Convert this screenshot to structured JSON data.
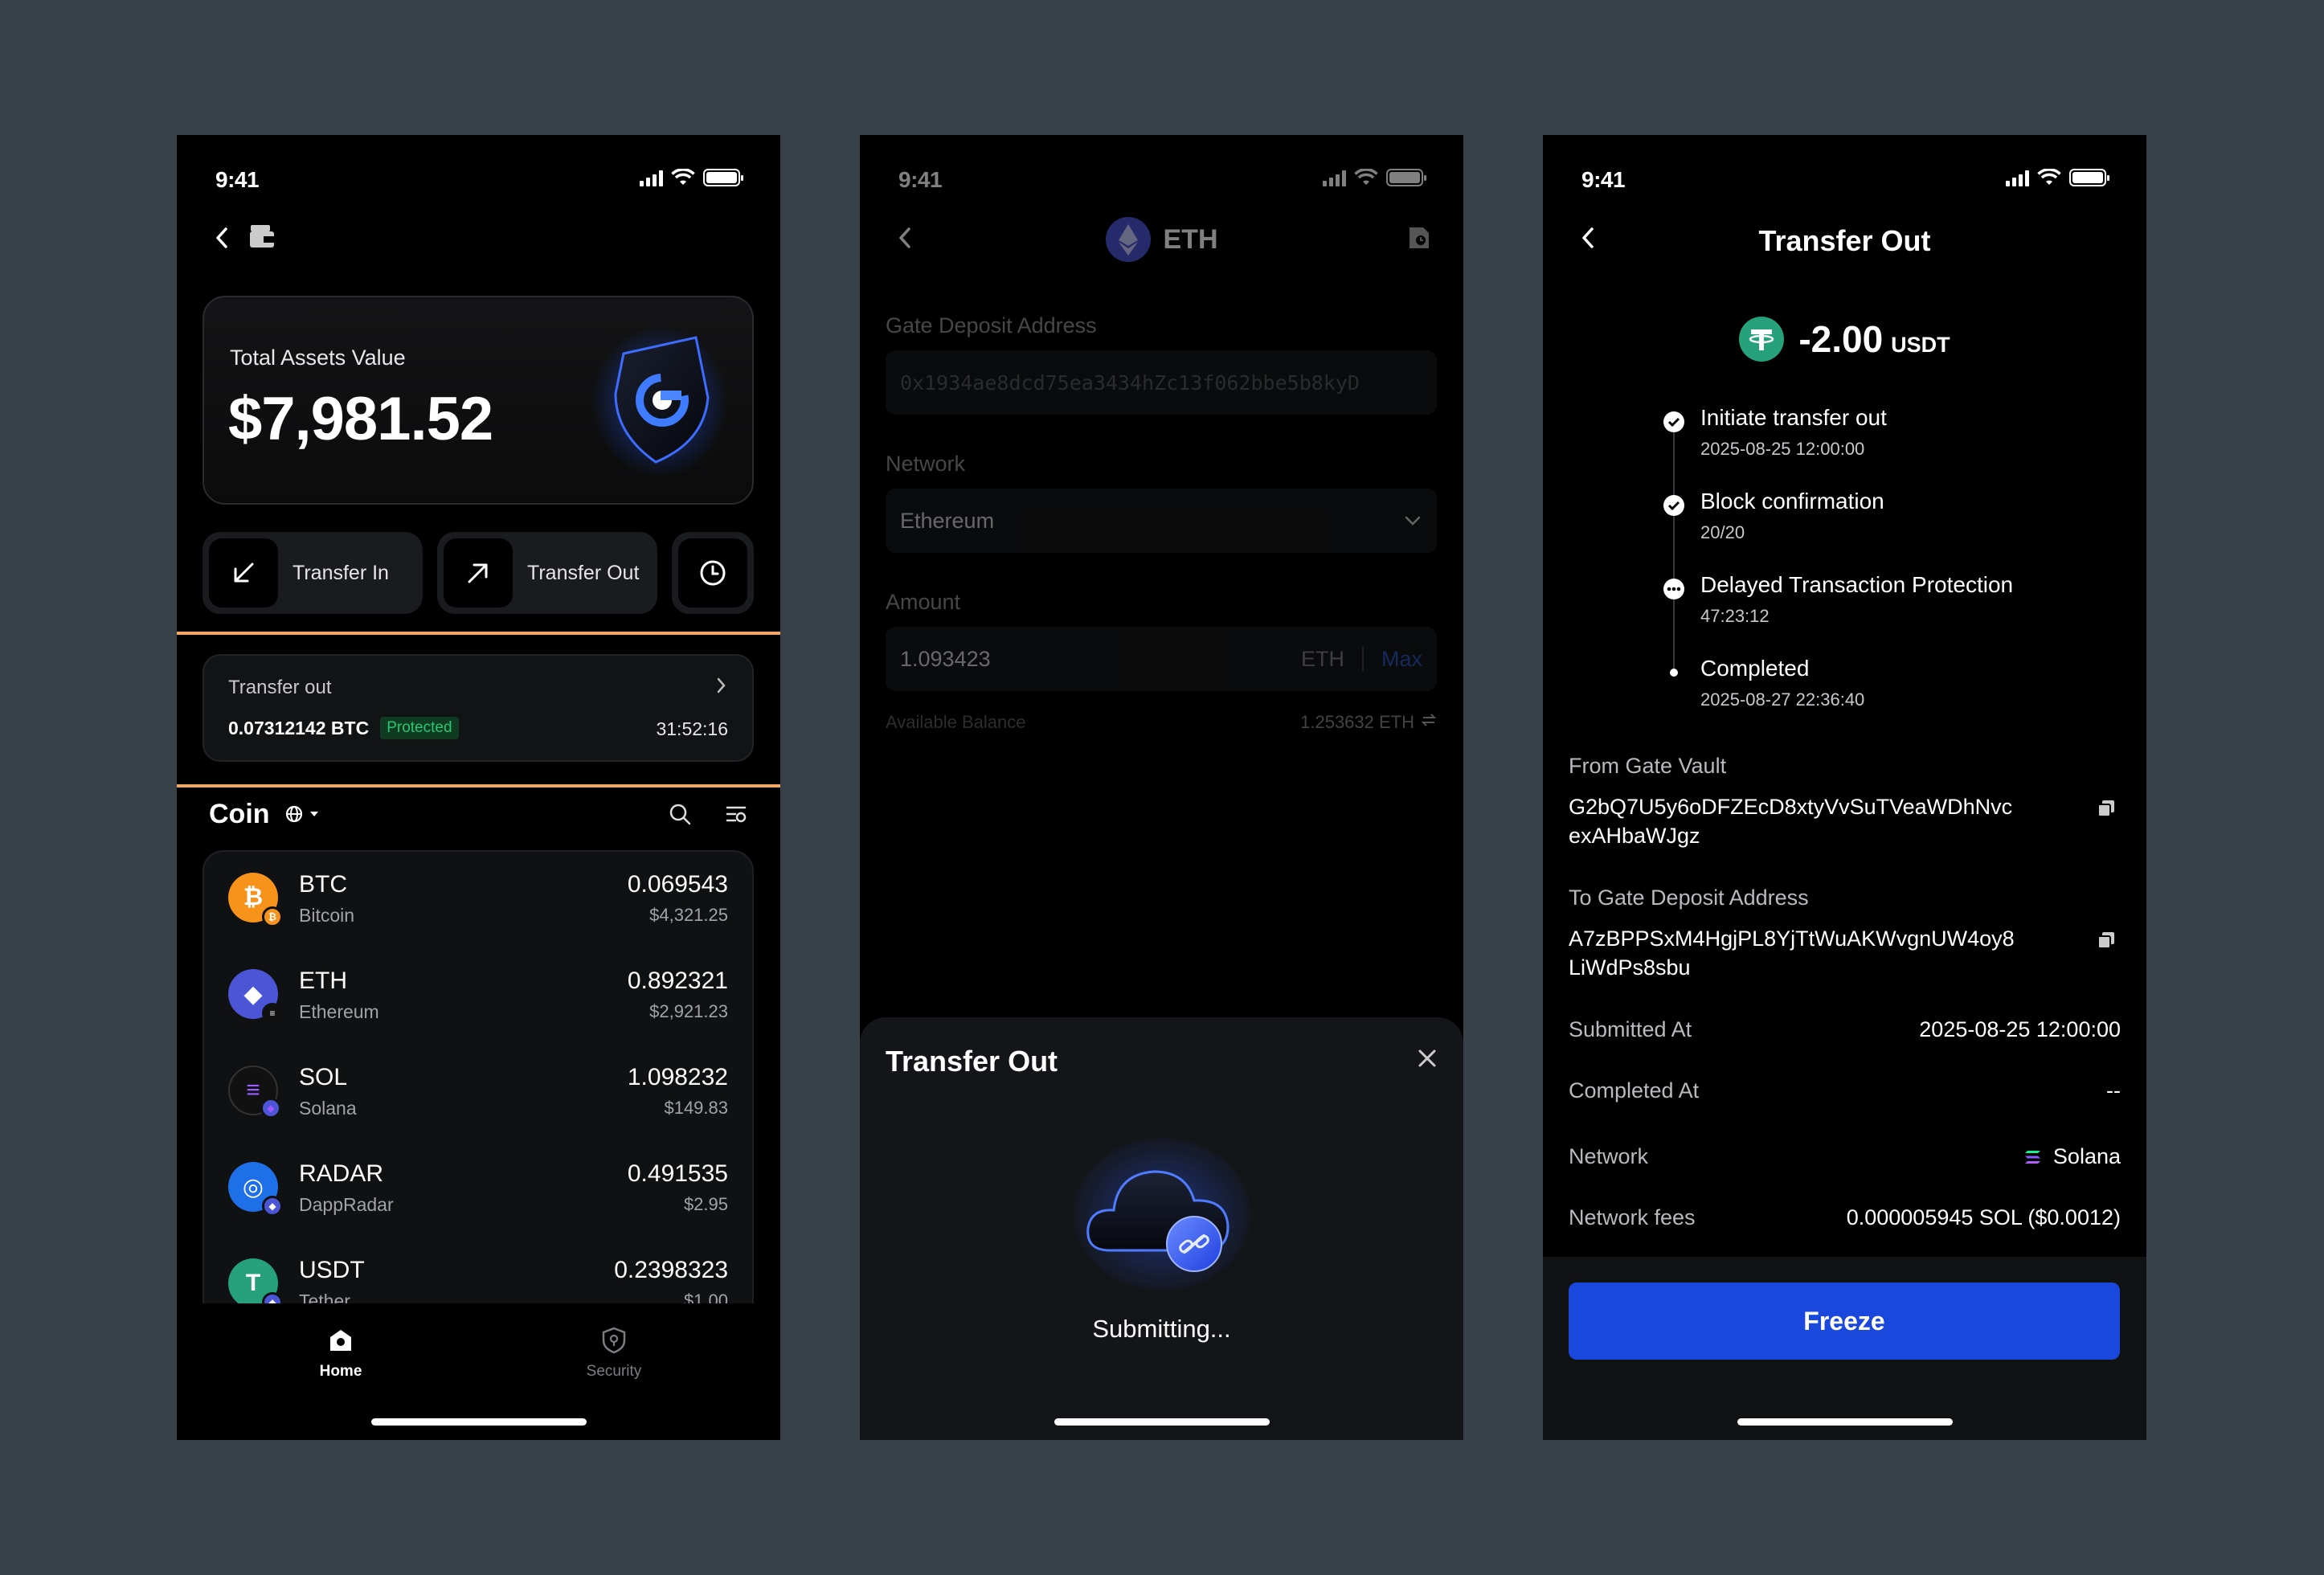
{
  "status_time": "9:41",
  "screen1": {
    "assets_label": "Total Assets Value",
    "assets_value": "$7,981.52",
    "actions": {
      "transfer_in": "Transfer In",
      "transfer_out": "Transfer Out"
    },
    "tx": {
      "title": "Transfer out",
      "amount": "0.07312142 BTC",
      "badge": "Protected",
      "timer": "31:52:16"
    },
    "coin_header": "Coin",
    "coins": [
      {
        "symbol": "BTC",
        "name": "Bitcoin",
        "amount": "0.069543",
        "usd": "$4,321.25",
        "color": "#f7931a",
        "glyph": "₿"
      },
      {
        "symbol": "ETH",
        "name": "Ethereum",
        "amount": "0.892321",
        "usd": "$2,921.23",
        "color": "#4b55d6",
        "glyph": "◆"
      },
      {
        "symbol": "SOL",
        "name": "Solana",
        "amount": "1.098232",
        "usd": "$149.83",
        "color": "#111111",
        "glyph": "≡"
      },
      {
        "symbol": "RADAR",
        "name": "DappRadar",
        "amount": "0.491535",
        "usd": "$2.95",
        "color": "#1f6fe8",
        "glyph": "◎"
      },
      {
        "symbol": "USDT",
        "name": "Tether",
        "amount": "0.2398323",
        "usd": "$1.00",
        "color": "#26a17b",
        "glyph": "T"
      }
    ],
    "tabs": {
      "home": "Home",
      "security": "Security"
    }
  },
  "screen2": {
    "title": "ETH",
    "deposit_label": "Gate Deposit Address",
    "deposit_address": "0x1934ae8dcd75ea3434hZc13f062bbe5b8kyD",
    "network_label": "Network",
    "network_value": "Ethereum",
    "amount_label": "Amount",
    "amount_value": "1.093423",
    "amount_unit": "ETH",
    "max_label": "Max",
    "available_label": "Available Balance",
    "available_value": "1.253632 ETH",
    "sheet_title": "Transfer Out",
    "sheet_status": "Submitting..."
  },
  "screen3": {
    "title": "Transfer Out",
    "amount": "-2.00",
    "currency": "USDT",
    "steps": [
      {
        "title": "Initiate transfer out",
        "detail": "2025-08-25 12:00:00"
      },
      {
        "title": "Block confirmation",
        "detail": "20/20"
      },
      {
        "title": "Delayed Transaction Protection",
        "detail": "47:23:12"
      },
      {
        "title": "Completed",
        "detail": "2025-08-27 22:36:40"
      }
    ],
    "from_label": "From Gate Vault",
    "from_address_1": "G2bQ7U5y6oDFZEcD8xtyVvSuTVeaWDhNvc",
    "from_address_2": "exAHbaWJgz",
    "to_label": "To Gate Deposit Address",
    "to_address_1": "A7zBPPSxM4HgjPL8YjTtWuAKWvgnUW4oy8",
    "to_address_2": "LiWdPs8sbu",
    "submitted_label": "Submitted At",
    "submitted_value": "2025-08-25 12:00:00",
    "completed_label": "Completed At",
    "completed_value": "--",
    "network_label": "Network",
    "network_value": "Solana",
    "fees_label": "Network fees",
    "fees_value": "0.000005945 SOL ($0.0012)",
    "freeze_label": "Freeze"
  },
  "colors": {
    "accent_blue": "#1a47dc",
    "highlight": "#f2a765",
    "protected_green": "#28c76f"
  }
}
